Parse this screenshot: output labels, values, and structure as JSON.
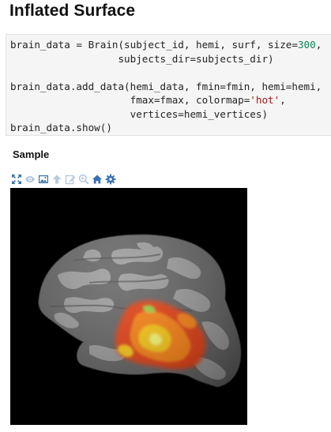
{
  "page": {
    "title": "Inflated Surface"
  },
  "code": {
    "segments": [
      {
        "t": "brain_data = Brain(subject_id, hemi, surf, size=",
        "k": "plain"
      },
      {
        "t": "300",
        "k": "num"
      },
      {
        "t": ",\n                  subjects_dir=subjects_dir)\n\nbrain_data.add_data(hemi_data, fmin=fmin, hemi=hemi,\n                    fmax=fmax, colormap=",
        "k": "plain"
      },
      {
        "t": "'hot'",
        "k": "str"
      },
      {
        "t": ",\n                    vertices=hemi_vertices)\nbrain_data.show()",
        "k": "plain"
      }
    ]
  },
  "sample": {
    "label": "Sample"
  },
  "toolbar": {
    "icons": [
      "expand-arrows-icon",
      "eye-icon",
      "image-icon",
      "arrow-up-icon",
      "edit-icon",
      "zoom-icon",
      "home-icon",
      "gear-icon"
    ],
    "active_color": "#3a6fb0",
    "disabled_color": "#b7c9df"
  },
  "figure": {
    "background": "#000000",
    "surface_dark": "#5a5a5a",
    "surface_light": "#9a9a9a",
    "overlay_colors": [
      "#8b0000",
      "#e63200",
      "#ff7a00",
      "#ffc800",
      "#ffff66"
    ]
  }
}
